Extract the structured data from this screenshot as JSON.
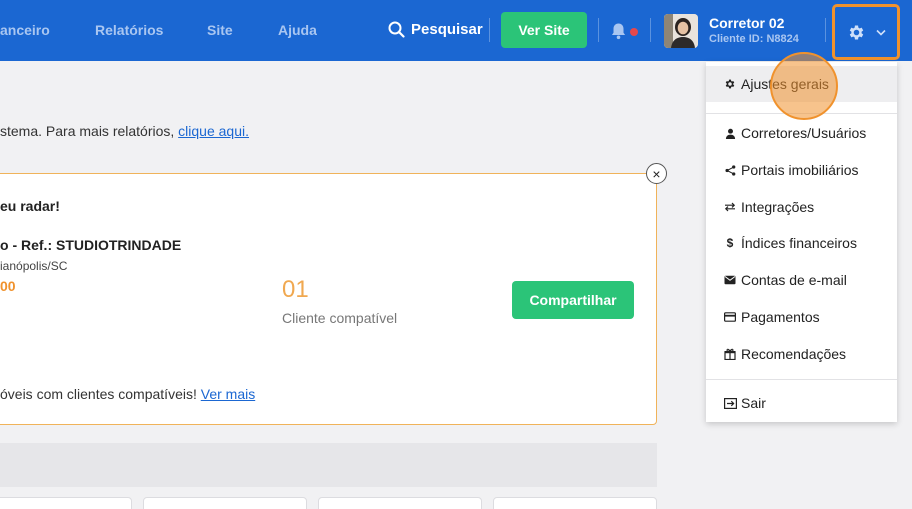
{
  "topbar": {
    "nav": [
      "anceiro",
      "Relatórios",
      "Site",
      "Ajuda"
    ],
    "search_label": "Pesquisar",
    "ver_site_label": "Ver Site",
    "user_name": "Corretor 02",
    "user_id": "Cliente ID: N8824"
  },
  "main": {
    "notice_text": "stema. Para mais relatórios, ",
    "notice_link": "clique aqui.",
    "radar_title": "eu radar!",
    "property_title": "o - Ref.: STUDIOTRINDADE",
    "property_location": "ianópolis/SC",
    "property_price": "00",
    "compatible_count": "01",
    "compatible_label": "Cliente compatível",
    "share_label": "Compartilhar",
    "matches_text": "óveis com clientes compatíveis! ",
    "matches_link": "Ver mais",
    "close_symbol": "×"
  },
  "dropdown": {
    "items": [
      {
        "label": "Ajustes gerais",
        "icon": "gear-icon"
      },
      {
        "label": "Corretores/Usuários",
        "icon": "user-icon"
      },
      {
        "label": "Portais imobiliários",
        "icon": "share-icon"
      },
      {
        "label": "Integrações",
        "icon": "arrows-icon"
      },
      {
        "label": "Índices financeiros",
        "icon": "dollar-icon"
      },
      {
        "label": "Contas de e-mail",
        "icon": "envelope-icon"
      },
      {
        "label": "Pagamentos",
        "icon": "credit-card-icon"
      },
      {
        "label": "Recomendações",
        "icon": "gift-icon"
      },
      {
        "label": "Sair",
        "icon": "logout-icon"
      }
    ]
  },
  "colors": {
    "topbar": "#1b67d2",
    "accent_orange": "#f0922d",
    "green": "#2bc478"
  }
}
